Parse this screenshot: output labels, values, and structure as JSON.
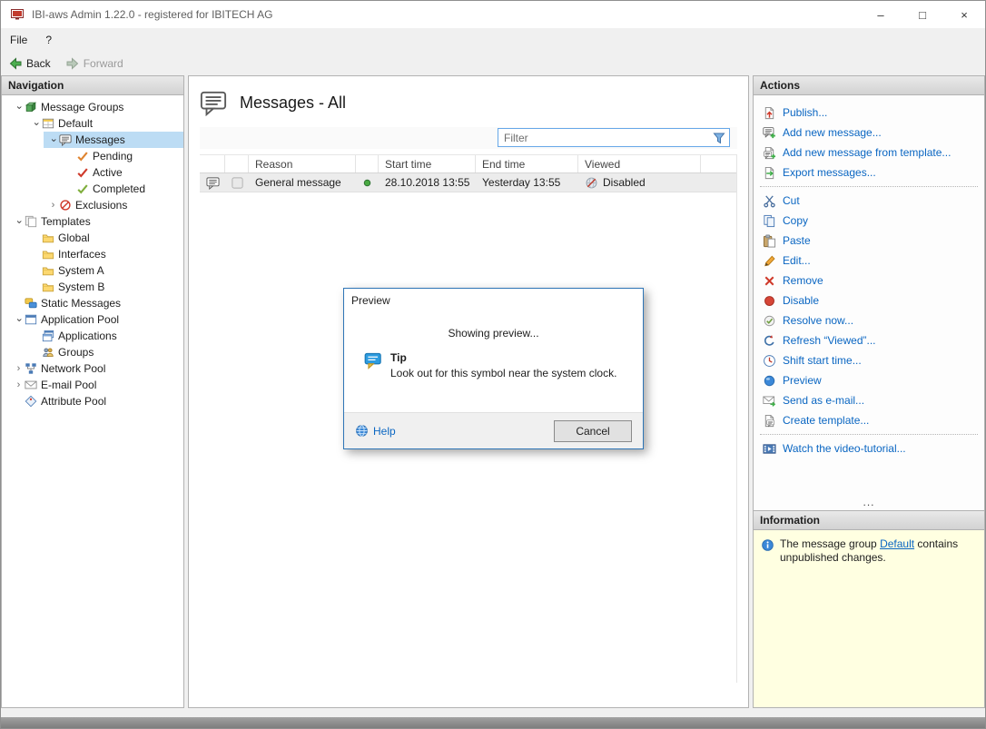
{
  "colors": {
    "selection": "#bcdcf4",
    "link_blue": "#0a66c2",
    "info_bg": "#ffffe1",
    "dialog_border": "#2e75b6",
    "status_green": "#49a942",
    "disabled_red": "#cf3a2b"
  },
  "window": {
    "title": "IBI-aws Admin 1.22.0 - registered for IBITECH AG",
    "minimize": "–",
    "maximize": "□",
    "close": "×"
  },
  "menu": {
    "file": "File",
    "help": "?"
  },
  "toolbar": {
    "back": "Back",
    "forward": "Forward"
  },
  "navigation": {
    "header": "Navigation",
    "items": [
      {
        "label": "Message Groups"
      },
      {
        "label": "Default"
      },
      {
        "label": "Messages"
      },
      {
        "label": "Pending"
      },
      {
        "label": "Active"
      },
      {
        "label": "Completed"
      },
      {
        "label": "Exclusions"
      },
      {
        "label": "Templates"
      },
      {
        "label": "Global"
      },
      {
        "label": "Interfaces"
      },
      {
        "label": "System A"
      },
      {
        "label": "System B"
      },
      {
        "label": "Static Messages"
      },
      {
        "label": "Application Pool"
      },
      {
        "label": "Applications"
      },
      {
        "label": "Groups"
      },
      {
        "label": "Network Pool"
      },
      {
        "label": "E-mail Pool"
      },
      {
        "label": "Attribute Pool"
      }
    ]
  },
  "main": {
    "title": "Messages - All",
    "filter_placeholder": "Filter",
    "table": {
      "headers": {
        "reason": "Reason",
        "start": "Start time",
        "end": "End time",
        "viewed": "Viewed"
      },
      "rows": [
        {
          "reason": "General message",
          "start": "28.10.2018 13:55",
          "end": "Yesterday 13:55",
          "viewed": "Disabled"
        }
      ]
    }
  },
  "dialog": {
    "title": "Preview",
    "status": "Showing preview...",
    "tip_title": "Tip",
    "tip_text": "Look out for this symbol near the system clock.",
    "help": "Help",
    "cancel": "Cancel"
  },
  "actions": {
    "header": "Actions",
    "items": [
      {
        "label": "Publish..."
      },
      {
        "label": "Add new message..."
      },
      {
        "label": "Add new message from template..."
      },
      {
        "label": "Export messages..."
      },
      {
        "label": "Cut"
      },
      {
        "label": "Copy"
      },
      {
        "label": "Paste"
      },
      {
        "label": "Edit..."
      },
      {
        "label": "Remove"
      },
      {
        "label": "Disable"
      },
      {
        "label": "Resolve now..."
      },
      {
        "label": "Refresh “Viewed”..."
      },
      {
        "label": "Shift start time..."
      },
      {
        "label": "Preview"
      },
      {
        "label": "Send as e-mail..."
      },
      {
        "label": "Create template..."
      },
      {
        "label": "Watch the video-tutorial..."
      }
    ],
    "overflow": "..."
  },
  "information": {
    "header": "Information",
    "text_before": "The message group ",
    "link_text": "Default",
    "text_after": " contains unpublished changes."
  }
}
